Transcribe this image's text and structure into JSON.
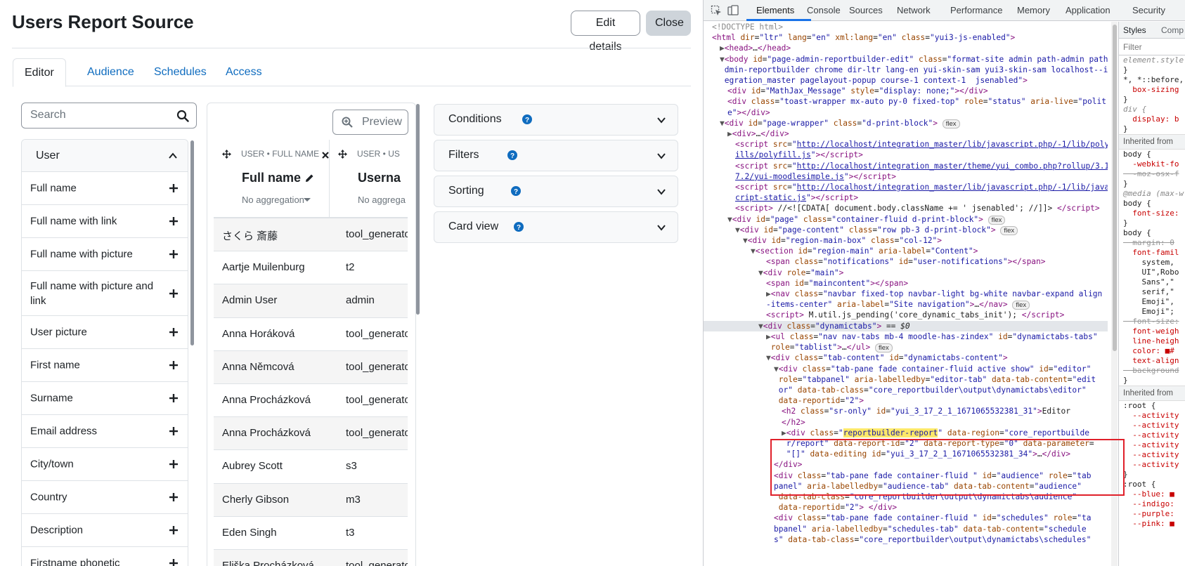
{
  "app": {
    "title": "Users Report Source",
    "edit_details_label": "Edit details",
    "close_label": "Close",
    "tabs": [
      {
        "label": "Editor"
      },
      {
        "label": "Audience"
      },
      {
        "label": "Schedules"
      },
      {
        "label": "Access"
      }
    ],
    "search": {
      "placeholder": "Search"
    },
    "field_group": {
      "label": "User"
    },
    "fields": [
      {
        "label": "Full name"
      },
      {
        "label": "Full name with link"
      },
      {
        "label": "Full name with picture"
      },
      {
        "label": "Full name with picture and link"
      },
      {
        "label": "User picture"
      },
      {
        "label": "First name"
      },
      {
        "label": "Surname"
      },
      {
        "label": "Email address"
      },
      {
        "label": "City/town"
      },
      {
        "label": "Country"
      },
      {
        "label": "Description"
      },
      {
        "label": "Firstname phonetic"
      }
    ],
    "preview_label": "Preview",
    "columns": [
      {
        "caption": "USER • FULL NAME",
        "title": "Full name",
        "aggregation": "No aggregation"
      },
      {
        "caption": "USER • US",
        "title": "Userna",
        "aggregation": "No aggrega"
      }
    ],
    "rows": [
      {
        "name": "さくら 斎藤",
        "username": "tool_generato"
      },
      {
        "name": "Aartje Muilenburg",
        "username": "t2"
      },
      {
        "name": "Admin User",
        "username": "admin"
      },
      {
        "name": "Anna Horáková",
        "username": "tool_generato"
      },
      {
        "name": "Anna Němcová",
        "username": "tool_generato"
      },
      {
        "name": "Anna Procházková",
        "username": "tool_generato"
      },
      {
        "name": "Anna Procházková",
        "username": "tool_generato"
      },
      {
        "name": "Aubrey Scott",
        "username": "s3"
      },
      {
        "name": "Cherly Gibson",
        "username": "m3"
      },
      {
        "name": "Eden Singh",
        "username": "t3"
      },
      {
        "name": "Eliška Procházková",
        "username": "tool_generato"
      }
    ],
    "accordions": [
      {
        "label": "Conditions"
      },
      {
        "label": "Filters"
      },
      {
        "label": "Sorting"
      },
      {
        "label": "Card view"
      }
    ]
  },
  "devtools": {
    "tabs": [
      {
        "label": "Elements"
      },
      {
        "label": "Console"
      },
      {
        "label": "Sources"
      },
      {
        "label": "Network"
      },
      {
        "label": "Performance"
      },
      {
        "label": "Memory"
      },
      {
        "label": "Application"
      },
      {
        "label": "Security"
      }
    ],
    "styles_tabs": [
      {
        "label": "Styles"
      },
      {
        "label": "Comp"
      }
    ],
    "styles_filter": "Filter",
    "styles_lines": [
      {
        "t": "element.style",
        "k": "muted"
      },
      {
        "t": "}",
        "k": ""
      },
      {
        "t": "*, *::before,",
        "k": ""
      },
      {
        "t": "  box-sizing",
        "k": "prop"
      },
      {
        "t": "}",
        "k": ""
      },
      {
        "t": "div {",
        "k": "muted"
      },
      {
        "t": "  display: b",
        "k": "prop"
      },
      {
        "t": "}",
        "k": ""
      },
      {
        "t": "Inherited from",
        "k": "sec"
      },
      {
        "t": "body {",
        "k": ""
      },
      {
        "t": "  -webkit-fo",
        "k": "prop"
      },
      {
        "t": "  -moz-osx-f",
        "k": "strike"
      },
      {
        "t": "}",
        "k": ""
      },
      {
        "t": "@media (max-w",
        "k": "muted"
      },
      {
        "t": "body {",
        "k": ""
      },
      {
        "t": "  font-size:",
        "k": "prop"
      },
      {
        "t": "}",
        "k": ""
      },
      {
        "t": "body {",
        "k": ""
      },
      {
        "t": "  margin: 0",
        "k": "strike"
      },
      {
        "t": "  font-famil",
        "k": "prop"
      },
      {
        "t": "    system,",
        "k": ""
      },
      {
        "t": "    UI\",Robo",
        "k": ""
      },
      {
        "t": "    Sans\",\"",
        "k": ""
      },
      {
        "t": "    serif,\"",
        "k": ""
      },
      {
        "t": "    Emoji\",",
        "k": ""
      },
      {
        "t": "    Emoji\";",
        "k": ""
      },
      {
        "t": "  font-size:",
        "k": "strike"
      },
      {
        "t": "  font-weigh",
        "k": "prop"
      },
      {
        "t": "  line-heigh",
        "k": "prop"
      },
      {
        "t": "  color: ■#",
        "k": "prop"
      },
      {
        "t": "  text-align",
        "k": "prop"
      },
      {
        "t": "  background",
        "k": "strike"
      },
      {
        "t": "}",
        "k": ""
      },
      {
        "t": "Inherited from",
        "k": "sec"
      },
      {
        "t": ":root {",
        "k": ""
      },
      {
        "t": "  --activity",
        "k": "prop"
      },
      {
        "t": "  --activity",
        "k": "prop"
      },
      {
        "t": "  --activity",
        "k": "prop"
      },
      {
        "t": "  --activity",
        "k": "prop"
      },
      {
        "t": "  --activity",
        "k": "prop"
      },
      {
        "t": "  --activity",
        "k": "prop"
      },
      {
        "t": "}",
        "k": ""
      },
      {
        "t": ":root {",
        "k": ""
      },
      {
        "t": "  --blue: ■",
        "k": "prop"
      },
      {
        "t": "  --indigo:",
        "k": "prop"
      },
      {
        "t": "  --purple:",
        "k": "prop"
      },
      {
        "t": "  --pink: ■",
        "k": "prop"
      }
    ],
    "lines": [
      {
        "indent": 0,
        "html": "<span class=\"doctype\">&lt;!DOCTYPE html&gt;</span>"
      },
      {
        "indent": 0,
        "html": "<span class=\"tag\">&lt;html</span> <span class=\"attr\">dir</span>=<span class=\"val\">\"ltr\"</span> <span class=\"attr\">lang</span>=<span class=\"val\">\"en\"</span> <span class=\"attr\">xml:lang</span>=<span class=\"val\">\"en\"</span> <span class=\"attr\">class</span>=<span class=\"val\">\"yui3-js-enabled\"</span><span class=\"tag\">&gt;</span>"
      },
      {
        "indent": 1,
        "html": "<span class=\"arr\">▶</span><span class=\"tag\">&lt;head&gt;</span>…<span class=\"tag\">&lt;/head&gt;</span>"
      },
      {
        "indent": 1,
        "html": "<span class=\"arr\">▼</span><span class=\"tag\">&lt;body</span> <span class=\"attr\">id</span>=<span class=\"val\">\"page-admin-reportbuilder-edit\"</span> <span class=\"attr\">class</span>=<span class=\"val\">\"format-site admin path-admin path-a</span>"
      },
      {
        "indent": 1,
        "html": "<span class=\"val\"> dmin-reportbuilder chrome dir-ltr lang-en yui-skin-sam yui3-skin-sam localhost--int</span>"
      },
      {
        "indent": 1,
        "html": "<span class=\"val\"> egration_master pagelayout-popup course-1 context-1  jsenabled\"</span><span class=\"tag\">&gt;</span>"
      },
      {
        "indent": 2,
        "html": "<span class=\"tag\">&lt;div</span> <span class=\"attr\">id</span>=<span class=\"val\">\"MathJax_Message\"</span> <span class=\"attr\">style</span>=<span class=\"val\">\"display: none;\"</span><span class=\"tag\">&gt;&lt;/div&gt;</span>"
      },
      {
        "indent": 2,
        "html": "<span class=\"tag\">&lt;div</span> <span class=\"attr\">class</span>=<span class=\"val\">\"toast-wrapper mx-auto py-0 fixed-top\"</span> <span class=\"attr\">role</span>=<span class=\"val\">\"status\"</span> <span class=\"attr\">aria-live</span>=<span class=\"val\">\"polit</span>"
      },
      {
        "indent": 2,
        "html": "<span class=\"val\">e\"</span><span class=\"tag\">&gt;&lt;/div&gt;</span>"
      },
      {
        "indent": 1,
        "html": "<span class=\"arr\">▼</span><span class=\"tag\">&lt;div</span> <span class=\"attr\">id</span>=<span class=\"val\">\"page-wrapper\"</span> <span class=\"attr\">class</span>=<span class=\"val\">\"d-print-block\"</span><span class=\"tag\">&gt;</span> <span class=\"badge\">flex</span>"
      },
      {
        "indent": 2,
        "html": "<span class=\"arr\">▶</span><span class=\"tag\">&lt;div&gt;</span>…<span class=\"tag\">&lt;/div&gt;</span>"
      },
      {
        "indent": 3,
        "html": "<span class=\"tag\">&lt;script</span> <span class=\"attr\">src</span>=<span class=\"val\">\"</span><span class=\"lnk\">http://localhost/integration_master/lib/javascript.php/-1/lib/polyf</span>"
      },
      {
        "indent": 3,
        "html": "<span class=\"lnk\">ills/polyfill.js</span><span class=\"val\">\"</span><span class=\"tag\">&gt;&lt;/script&gt;</span>"
      },
      {
        "indent": 3,
        "html": "<span class=\"tag\">&lt;script</span> <span class=\"attr\">src</span>=<span class=\"val\">\"</span><span class=\"lnk\">http://localhost/integration_master/theme/yui_combo.php?rollup/3.1</span>"
      },
      {
        "indent": 3,
        "html": "<span class=\"lnk\">7.2/yui-moodlesimple.js</span><span class=\"val\">\"</span><span class=\"tag\">&gt;&lt;/script&gt;</span>"
      },
      {
        "indent": 3,
        "html": "<span class=\"tag\">&lt;script</span> <span class=\"attr\">src</span>=<span class=\"val\">\"</span><span class=\"lnk\">http://localhost/integration_master/lib/javascript.php/-1/lib/javas</span>"
      },
      {
        "indent": 3,
        "html": "<span class=\"lnk\">cript-static.js</span><span class=\"val\">\"</span><span class=\"tag\">&gt;&lt;/script&gt;</span>"
      },
      {
        "indent": 3,
        "html": "<span class=\"tag\">&lt;script&gt;</span> //&lt;![CDATA[ document.body.className += ' jsenabled'; //]]&gt; <span class=\"tag\">&lt;/script&gt;</span>"
      },
      {
        "indent": 2,
        "html": "<span class=\"arr\">▼</span><span class=\"tag\">&lt;div</span> <span class=\"attr\">id</span>=<span class=\"val\">\"page\"</span> <span class=\"attr\">class</span>=<span class=\"val\">\"container-fluid d-print-block\"</span><span class=\"tag\">&gt;</span> <span class=\"badge\">flex</span>"
      },
      {
        "indent": 3,
        "html": "<span class=\"arr\">▼</span><span class=\"tag\">&lt;div</span> <span class=\"attr\">id</span>=<span class=\"val\">\"page-content\"</span> <span class=\"attr\">class</span>=<span class=\"val\">\"row pb-3 d-print-block\"</span><span class=\"tag\">&gt;</span> <span class=\"badge\">flex</span>"
      },
      {
        "indent": 4,
        "html": "<span class=\"arr\">▼</span><span class=\"tag\">&lt;div</span> <span class=\"attr\">id</span>=<span class=\"val\">\"region-main-box\"</span> <span class=\"attr\">class</span>=<span class=\"val\">\"col-12\"</span><span class=\"tag\">&gt;</span>"
      },
      {
        "indent": 5,
        "html": "<span class=\"arr\">▼</span><span class=\"tag\">&lt;section</span> <span class=\"attr\">id</span>=<span class=\"val\">\"region-main\"</span> <span class=\"attr\">aria-label</span>=<span class=\"val\">\"Content\"</span><span class=\"tag\">&gt;</span>"
      },
      {
        "indent": 7,
        "html": "<span class=\"tag\">&lt;span</span> <span class=\"attr\">class</span>=<span class=\"val\">\"notifications\"</span> <span class=\"attr\">id</span>=<span class=\"val\">\"user-notifications\"</span><span class=\"tag\">&gt;&lt;/span&gt;</span>"
      },
      {
        "indent": 6,
        "html": "<span class=\"arr\">▼</span><span class=\"tag\">&lt;div</span> <span class=\"attr\">role</span>=<span class=\"val\">\"main\"</span><span class=\"tag\">&gt;</span>"
      },
      {
        "indent": 7,
        "html": "<span class=\"tag\">&lt;span</span> <span class=\"attr\">id</span>=<span class=\"val\">\"maincontent\"</span><span class=\"tag\">&gt;&lt;/span&gt;</span>"
      },
      {
        "indent": 7,
        "html": "<span class=\"arr\">▶</span><span class=\"tag\">&lt;nav</span> <span class=\"attr\">class</span>=<span class=\"val\">\"navbar fixed-top navbar-light bg-white navbar-expand align</span>"
      },
      {
        "indent": 7,
        "html": "<span class=\"val\">-items-center\"</span> <span class=\"attr\">aria-label</span>=<span class=\"val\">\"Site navigation\"</span><span class=\"tag\">&gt;</span>…<span class=\"tag\">&lt;/nav&gt;</span> <span class=\"badge\">flex</span>"
      },
      {
        "indent": 7,
        "html": "<span class=\"tag\">&lt;script&gt;</span> M.util.js_pending('core_dynamic_tabs_init'); <span class=\"tag\">&lt;/script&gt;</span>"
      },
      {
        "indent": 6,
        "sel": true,
        "html": "<span class=\"arr\">▼</span><span class=\"tag\">&lt;div</span> <span class=\"attr\">class</span>=<span class=\"val\">\"dynamictabs\"</span><span class=\"tag\">&gt;</span> == <i>$0</i>"
      },
      {
        "indent": 7,
        "html": "<span class=\"arr\">▶</span><span class=\"tag\">&lt;ul</span> <span class=\"attr\">class</span>=<span class=\"val\">\"nav nav-tabs mb-4 moodle-has-zindex\"</span> <span class=\"attr\">id</span>=<span class=\"val\">\"dynamictabs-tabs\"</span>"
      },
      {
        "indent": 7,
        "html": " <span class=\"attr\">role</span>=<span class=\"val\">\"tablist\"</span><span class=\"tag\">&gt;</span>…<span class=\"tag\">&lt;/ul&gt;</span> <span class=\"badge\">flex</span>"
      },
      {
        "indent": 7,
        "html": "<span class=\"arr\">▼</span><span class=\"tag\">&lt;div</span> <span class=\"attr\">class</span>=<span class=\"val\">\"tab-content\"</span> <span class=\"attr\">id</span>=<span class=\"val\">\"dynamictabs-content\"</span><span class=\"tag\">&gt;</span>"
      },
      {
        "indent": 8,
        "html": "<span class=\"arr\">▼</span><span class=\"tag\">&lt;div</span> <span class=\"attr\">class</span>=<span class=\"val\">\"tab-pane fade container-fluid active show\"</span> <span class=\"attr\">id</span>=<span class=\"val\">\"editor\"</span>"
      },
      {
        "indent": 8,
        "html": " <span class=\"attr\">role</span>=<span class=\"val\">\"tabpanel\"</span> <span class=\"attr\">aria-labelledby</span>=<span class=\"val\">\"editor-tab\"</span> <span class=\"attr\">data-tab-content</span>=<span class=\"val\">\"edit</span>"
      },
      {
        "indent": 8,
        "html": "<span class=\"val\"> or\"</span> <span class=\"attr\">data-tab-class</span>=<span class=\"val\">\"core_reportbuilder\\output\\dynamictabs\\editor\"</span>"
      },
      {
        "indent": 8,
        "html": " <span class=\"attr\">data-reportid</span>=<span class=\"val\">\"2\"</span><span class=\"tag\">&gt;</span>"
      },
      {
        "indent": 9,
        "html": "<span class=\"tag\">&lt;h2</span> <span class=\"attr\">class</span>=<span class=\"val\">\"sr-only\"</span> <span class=\"attr\">id</span>=<span class=\"val\">\"yui_3_17_2_1_1671065532381_31\"</span><span class=\"tag\">&gt;</span>Editor"
      },
      {
        "indent": 9,
        "html": "<span class=\"tag\">&lt;/h2&gt;</span>"
      },
      {
        "indent": 9,
        "html": "<span class=\"arr\">▶</span><span class=\"tag\">&lt;div</span> <span class=\"attr\">class</span>=<span class=\"val\">\"<span class=\"hl\">reportbuilder-report</span>\"</span> <span class=\"attr\">data-region</span>=<span class=\"val\">\"core_reportbuilde</span>"
      },
      {
        "indent": 9,
        "html": "<span class=\"val\"> r/report\"</span> <span class=\"attr\">data-report-id</span>=<span class=\"val\">\"2\"</span> <span class=\"attr\">data-report-type</span>=<span class=\"val\">\"0\"</span> <span class=\"attr\">data-parameter</span>="
      },
      {
        "indent": 9,
        "html": "<span class=\"val\"> \"[]\"</span> <span class=\"attr\">data-editing</span> <span class=\"attr\">id</span>=<span class=\"val\">\"yui_3_17_2_1_1671065532381_34\"</span><span class=\"tag\">&gt;</span>…<span class=\"tag\">&lt;/div&gt;</span>"
      },
      {
        "indent": 8,
        "html": "<span class=\"tag\">&lt;/div&gt;</span>"
      },
      {
        "indent": 8,
        "html": "<span class=\"tag\">&lt;div</span> <span class=\"attr\">class</span>=<span class=\"val\">\"tab-pane fade container-fluid \"</span> <span class=\"attr\">id</span>=<span class=\"val\">\"audience\"</span> <span class=\"attr\">role</span>=<span class=\"val\">\"tab</span>"
      },
      {
        "indent": 8,
        "html": "<span class=\"val\">panel\"</span> <span class=\"attr\">aria-labelledby</span>=<span class=\"val\">\"audience-tab\"</span> <span class=\"attr\">data-tab-content</span>=<span class=\"val\">\"audience\"</span>"
      },
      {
        "indent": 8,
        "html": " <span class=\"attr\">data-tab-class</span>=<span class=\"val\">\"core_reportbuilder\\output\\dynamictabs\\audience\"</span>"
      },
      {
        "indent": 8,
        "html": " <span class=\"attr\">data-reportid</span>=<span class=\"val\">\"2\"</span><span class=\"tag\">&gt; &lt;/div&gt;</span>"
      },
      {
        "indent": 8,
        "html": "<span class=\"tag\">&lt;div</span> <span class=\"attr\">class</span>=<span class=\"val\">\"tab-pane fade container-fluid \"</span> <span class=\"attr\">id</span>=<span class=\"val\">\"schedules\"</span> <span class=\"attr\">role</span>=<span class=\"val\">\"ta</span>"
      },
      {
        "indent": 8,
        "html": "<span class=\"val\">bpanel\"</span> <span class=\"attr\">aria-labelledby</span>=<span class=\"val\">\"schedules-tab\"</span> <span class=\"attr\">data-tab-content</span>=<span class=\"val\">\"schedule</span>"
      },
      {
        "indent": 8,
        "html": "<span class=\"val\">s\"</span> <span class=\"attr\">data-tab-class</span>=<span class=\"val\">\"core_reportbuilder\\output\\dynamictabs\\schedules\"</span>"
      }
    ]
  }
}
